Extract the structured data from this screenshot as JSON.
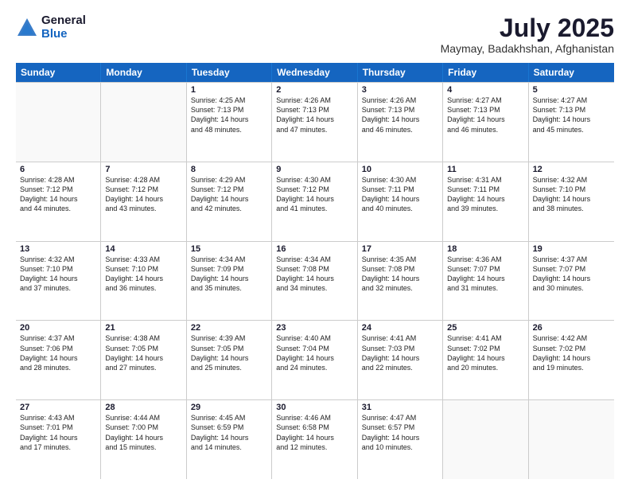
{
  "header": {
    "logo_general": "General",
    "logo_blue": "Blue",
    "month_year": "July 2025",
    "location": "Maymay, Badakhshan, Afghanistan"
  },
  "weekdays": [
    "Sunday",
    "Monday",
    "Tuesday",
    "Wednesday",
    "Thursday",
    "Friday",
    "Saturday"
  ],
  "weeks": [
    [
      {
        "day": "",
        "empty": true
      },
      {
        "day": "",
        "empty": true
      },
      {
        "day": "1",
        "lines": [
          "Sunrise: 4:25 AM",
          "Sunset: 7:13 PM",
          "Daylight: 14 hours",
          "and 48 minutes."
        ]
      },
      {
        "day": "2",
        "lines": [
          "Sunrise: 4:26 AM",
          "Sunset: 7:13 PM",
          "Daylight: 14 hours",
          "and 47 minutes."
        ]
      },
      {
        "day": "3",
        "lines": [
          "Sunrise: 4:26 AM",
          "Sunset: 7:13 PM",
          "Daylight: 14 hours",
          "and 46 minutes."
        ]
      },
      {
        "day": "4",
        "lines": [
          "Sunrise: 4:27 AM",
          "Sunset: 7:13 PM",
          "Daylight: 14 hours",
          "and 46 minutes."
        ]
      },
      {
        "day": "5",
        "lines": [
          "Sunrise: 4:27 AM",
          "Sunset: 7:13 PM",
          "Daylight: 14 hours",
          "and 45 minutes."
        ]
      }
    ],
    [
      {
        "day": "6",
        "lines": [
          "Sunrise: 4:28 AM",
          "Sunset: 7:12 PM",
          "Daylight: 14 hours",
          "and 44 minutes."
        ]
      },
      {
        "day": "7",
        "lines": [
          "Sunrise: 4:28 AM",
          "Sunset: 7:12 PM",
          "Daylight: 14 hours",
          "and 43 minutes."
        ]
      },
      {
        "day": "8",
        "lines": [
          "Sunrise: 4:29 AM",
          "Sunset: 7:12 PM",
          "Daylight: 14 hours",
          "and 42 minutes."
        ]
      },
      {
        "day": "9",
        "lines": [
          "Sunrise: 4:30 AM",
          "Sunset: 7:12 PM",
          "Daylight: 14 hours",
          "and 41 minutes."
        ]
      },
      {
        "day": "10",
        "lines": [
          "Sunrise: 4:30 AM",
          "Sunset: 7:11 PM",
          "Daylight: 14 hours",
          "and 40 minutes."
        ]
      },
      {
        "day": "11",
        "lines": [
          "Sunrise: 4:31 AM",
          "Sunset: 7:11 PM",
          "Daylight: 14 hours",
          "and 39 minutes."
        ]
      },
      {
        "day": "12",
        "lines": [
          "Sunrise: 4:32 AM",
          "Sunset: 7:10 PM",
          "Daylight: 14 hours",
          "and 38 minutes."
        ]
      }
    ],
    [
      {
        "day": "13",
        "lines": [
          "Sunrise: 4:32 AM",
          "Sunset: 7:10 PM",
          "Daylight: 14 hours",
          "and 37 minutes."
        ]
      },
      {
        "day": "14",
        "lines": [
          "Sunrise: 4:33 AM",
          "Sunset: 7:10 PM",
          "Daylight: 14 hours",
          "and 36 minutes."
        ]
      },
      {
        "day": "15",
        "lines": [
          "Sunrise: 4:34 AM",
          "Sunset: 7:09 PM",
          "Daylight: 14 hours",
          "and 35 minutes."
        ]
      },
      {
        "day": "16",
        "lines": [
          "Sunrise: 4:34 AM",
          "Sunset: 7:08 PM",
          "Daylight: 14 hours",
          "and 34 minutes."
        ]
      },
      {
        "day": "17",
        "lines": [
          "Sunrise: 4:35 AM",
          "Sunset: 7:08 PM",
          "Daylight: 14 hours",
          "and 32 minutes."
        ]
      },
      {
        "day": "18",
        "lines": [
          "Sunrise: 4:36 AM",
          "Sunset: 7:07 PM",
          "Daylight: 14 hours",
          "and 31 minutes."
        ]
      },
      {
        "day": "19",
        "lines": [
          "Sunrise: 4:37 AM",
          "Sunset: 7:07 PM",
          "Daylight: 14 hours",
          "and 30 minutes."
        ]
      }
    ],
    [
      {
        "day": "20",
        "lines": [
          "Sunrise: 4:37 AM",
          "Sunset: 7:06 PM",
          "Daylight: 14 hours",
          "and 28 minutes."
        ]
      },
      {
        "day": "21",
        "lines": [
          "Sunrise: 4:38 AM",
          "Sunset: 7:05 PM",
          "Daylight: 14 hours",
          "and 27 minutes."
        ]
      },
      {
        "day": "22",
        "lines": [
          "Sunrise: 4:39 AM",
          "Sunset: 7:05 PM",
          "Daylight: 14 hours",
          "and 25 minutes."
        ]
      },
      {
        "day": "23",
        "lines": [
          "Sunrise: 4:40 AM",
          "Sunset: 7:04 PM",
          "Daylight: 14 hours",
          "and 24 minutes."
        ]
      },
      {
        "day": "24",
        "lines": [
          "Sunrise: 4:41 AM",
          "Sunset: 7:03 PM",
          "Daylight: 14 hours",
          "and 22 minutes."
        ]
      },
      {
        "day": "25",
        "lines": [
          "Sunrise: 4:41 AM",
          "Sunset: 7:02 PM",
          "Daylight: 14 hours",
          "and 20 minutes."
        ]
      },
      {
        "day": "26",
        "lines": [
          "Sunrise: 4:42 AM",
          "Sunset: 7:02 PM",
          "Daylight: 14 hours",
          "and 19 minutes."
        ]
      }
    ],
    [
      {
        "day": "27",
        "lines": [
          "Sunrise: 4:43 AM",
          "Sunset: 7:01 PM",
          "Daylight: 14 hours",
          "and 17 minutes."
        ]
      },
      {
        "day": "28",
        "lines": [
          "Sunrise: 4:44 AM",
          "Sunset: 7:00 PM",
          "Daylight: 14 hours",
          "and 15 minutes."
        ]
      },
      {
        "day": "29",
        "lines": [
          "Sunrise: 4:45 AM",
          "Sunset: 6:59 PM",
          "Daylight: 14 hours",
          "and 14 minutes."
        ]
      },
      {
        "day": "30",
        "lines": [
          "Sunrise: 4:46 AM",
          "Sunset: 6:58 PM",
          "Daylight: 14 hours",
          "and 12 minutes."
        ]
      },
      {
        "day": "31",
        "lines": [
          "Sunrise: 4:47 AM",
          "Sunset: 6:57 PM",
          "Daylight: 14 hours",
          "and 10 minutes."
        ]
      },
      {
        "day": "",
        "empty": true
      },
      {
        "day": "",
        "empty": true
      }
    ]
  ]
}
